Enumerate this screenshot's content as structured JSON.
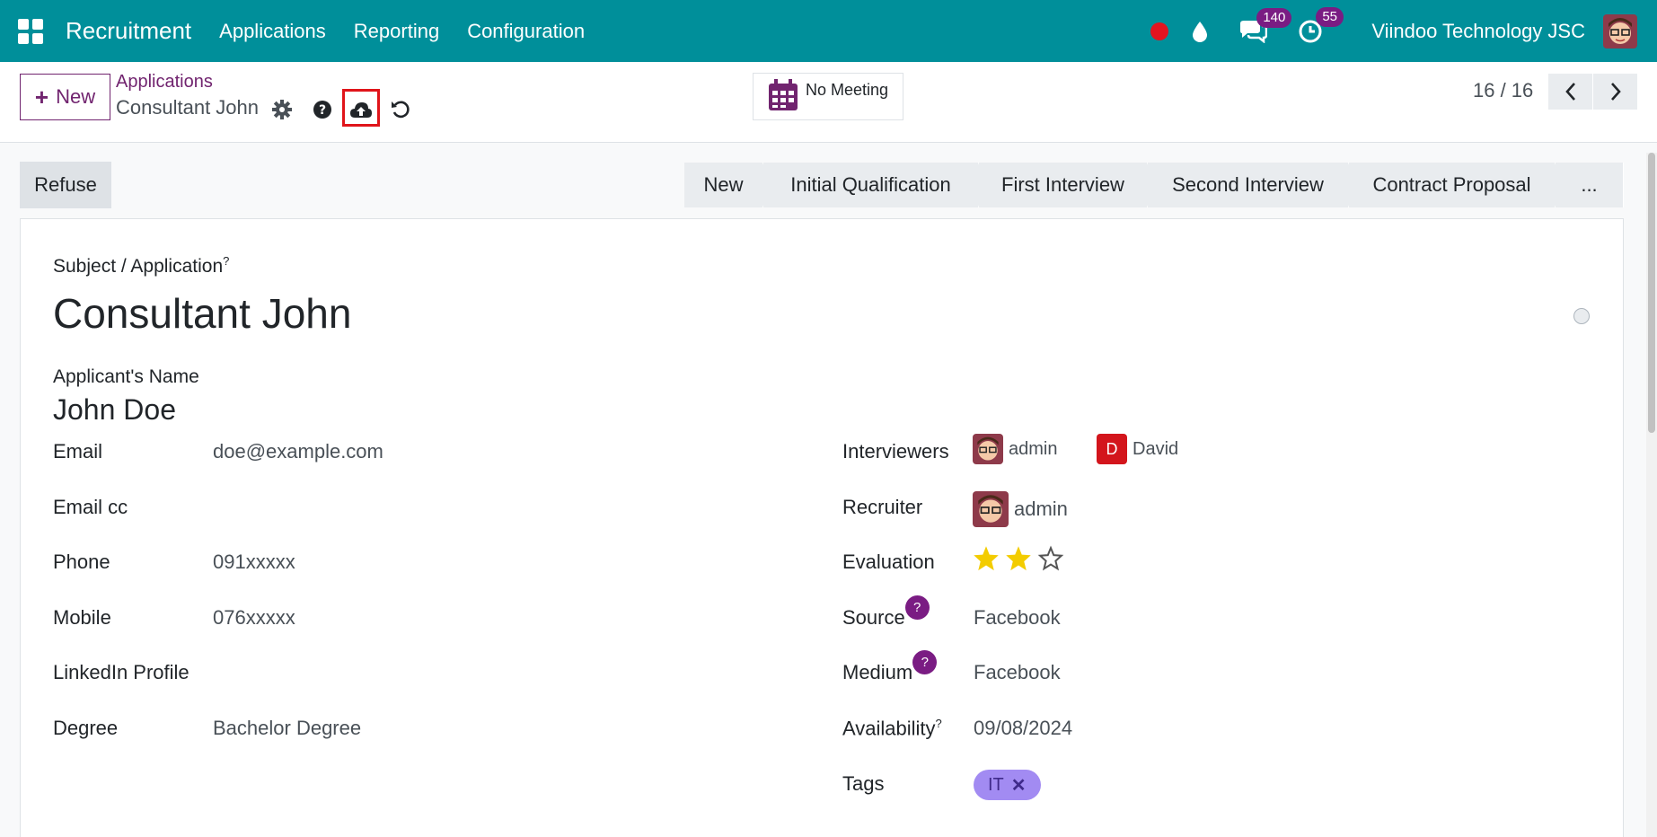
{
  "navbar": {
    "app_name": "Recruitment",
    "menu": [
      "Applications",
      "Reporting",
      "Configuration"
    ],
    "messages_count": "140",
    "activities_count": "55",
    "company": "Viindoo Technology JSC",
    "accent": "#008f9a"
  },
  "control": {
    "new_label": "New",
    "breadcrumb_parent": "Applications",
    "breadcrumb_current": "Consultant John",
    "meeting_label": "No Meeting",
    "pager": "16 / 16"
  },
  "statusbar": {
    "refuse_label": "Refuse",
    "stages": [
      "New",
      "Initial Qualification",
      "First Interview",
      "Second Interview",
      "Contract Proposal",
      "..."
    ]
  },
  "form": {
    "subject_label": "Subject / Application",
    "subject_sup": "?",
    "title": "Consultant John",
    "applicant_name_label": "Applicant's Name",
    "applicant_name": "John Doe",
    "left_fields": [
      {
        "label": "Email",
        "value": "doe@example.com"
      },
      {
        "label": "Email cc",
        "value": ""
      },
      {
        "label": "Phone",
        "value": "091xxxxx"
      },
      {
        "label": "Mobile",
        "value": "076xxxxx"
      },
      {
        "label": "LinkedIn Profile",
        "value": ""
      },
      {
        "label": "Degree",
        "value": "Bachelor Degree"
      }
    ],
    "interviewers_label": "Interviewers",
    "interviewers": [
      "admin",
      "David"
    ],
    "david_initial": "D",
    "recruiter_label": "Recruiter",
    "recruiter": "admin",
    "evaluation_label": "Evaluation",
    "evaluation_stars": 2,
    "evaluation_max": 3,
    "source_label": "Source",
    "source_value": "Facebook",
    "medium_label": "Medium",
    "medium_value": "Facebook",
    "help_glyph": "?",
    "availability_label": "Availability",
    "availability_sup": "?",
    "availability_value": "09/08/2024",
    "tags_label": "Tags",
    "tags": [
      "IT"
    ]
  }
}
